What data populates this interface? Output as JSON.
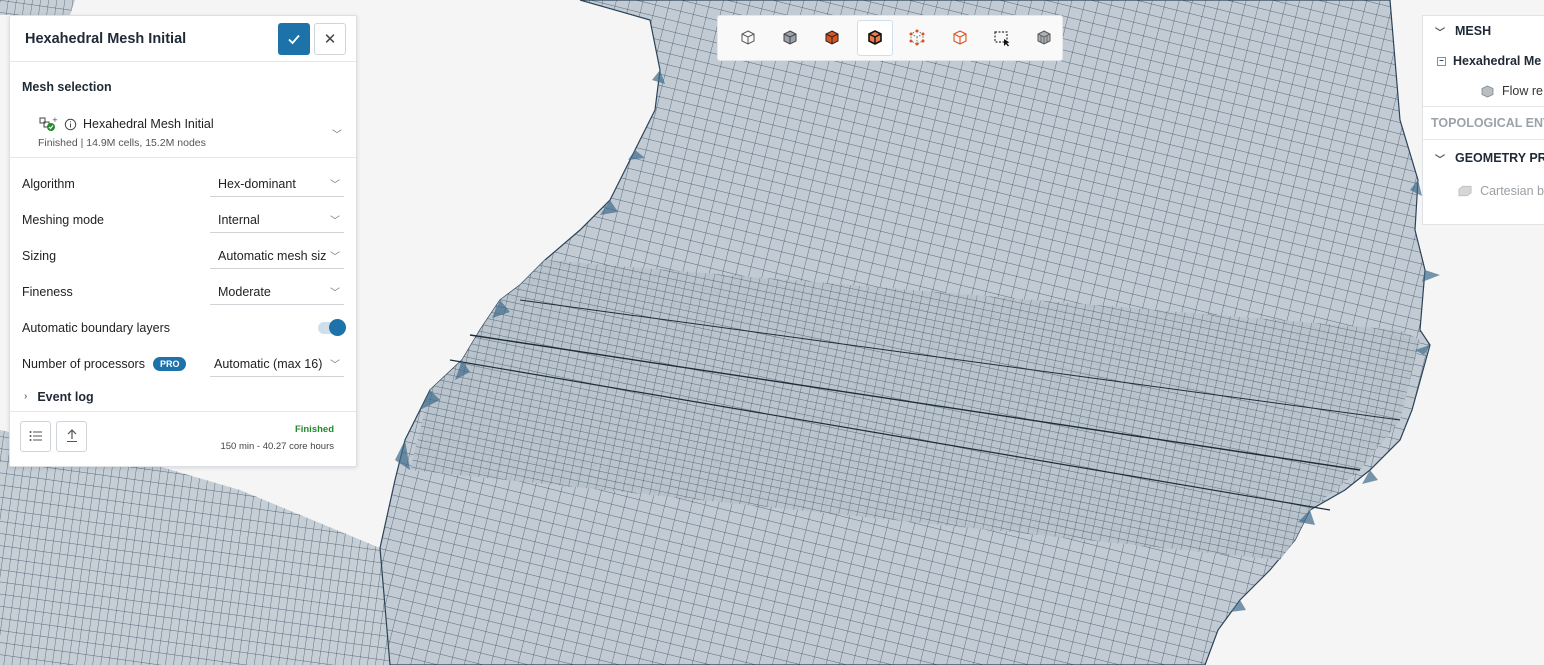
{
  "panel": {
    "title": "Hexahedral Mesh Initial",
    "mesh_selection_label": "Mesh selection",
    "selected_mesh": {
      "name": "Hexahedral Mesh Initial",
      "info": "Finished | 14.9M cells, 15.2M nodes"
    },
    "fields": {
      "algorithm": {
        "label": "Algorithm",
        "value": "Hex-dominant"
      },
      "meshing_mode": {
        "label": "Meshing mode",
        "value": "Internal"
      },
      "sizing": {
        "label": "Sizing",
        "value": "Automatic mesh siz"
      },
      "fineness": {
        "label": "Fineness",
        "value": "Moderate"
      },
      "boundary_layers": {
        "label": "Automatic boundary layers",
        "enabled": true
      },
      "processors": {
        "label": "Number of processors",
        "badge": "PRO",
        "value": "Automatic (max 16)"
      }
    },
    "event_log_label": "Event log",
    "status": "Finished",
    "run_time": "150 min - 40.27 core hours"
  },
  "toolbar": {
    "buttons": [
      {
        "icon": "cube-outline-icon"
      },
      {
        "icon": "cube-solid-icon"
      },
      {
        "icon": "cube-orange-solid-icon"
      },
      {
        "icon": "cube-orange-edges-icon",
        "active": true
      },
      {
        "icon": "cube-vertices-icon"
      },
      {
        "icon": "cube-orange-outline-icon"
      },
      {
        "icon": "box-select-icon"
      },
      {
        "icon": "cube-hidden-icon"
      }
    ]
  },
  "tree": {
    "mesh_header": "MESH",
    "mesh_item": "Hexahedral Me",
    "flow_region": "Flow re",
    "topological": "TOPOLOGICAL ENT",
    "geometry_header": "GEOMETRY PR",
    "geometry_item": "Cartesian b"
  },
  "colors": {
    "accent": "#1d72aa",
    "mesh_fill": "#c3ccd4",
    "mesh_line": "#2c3e50",
    "status_ok": "#238a2e",
    "highlight_orange": "#d9541e"
  }
}
